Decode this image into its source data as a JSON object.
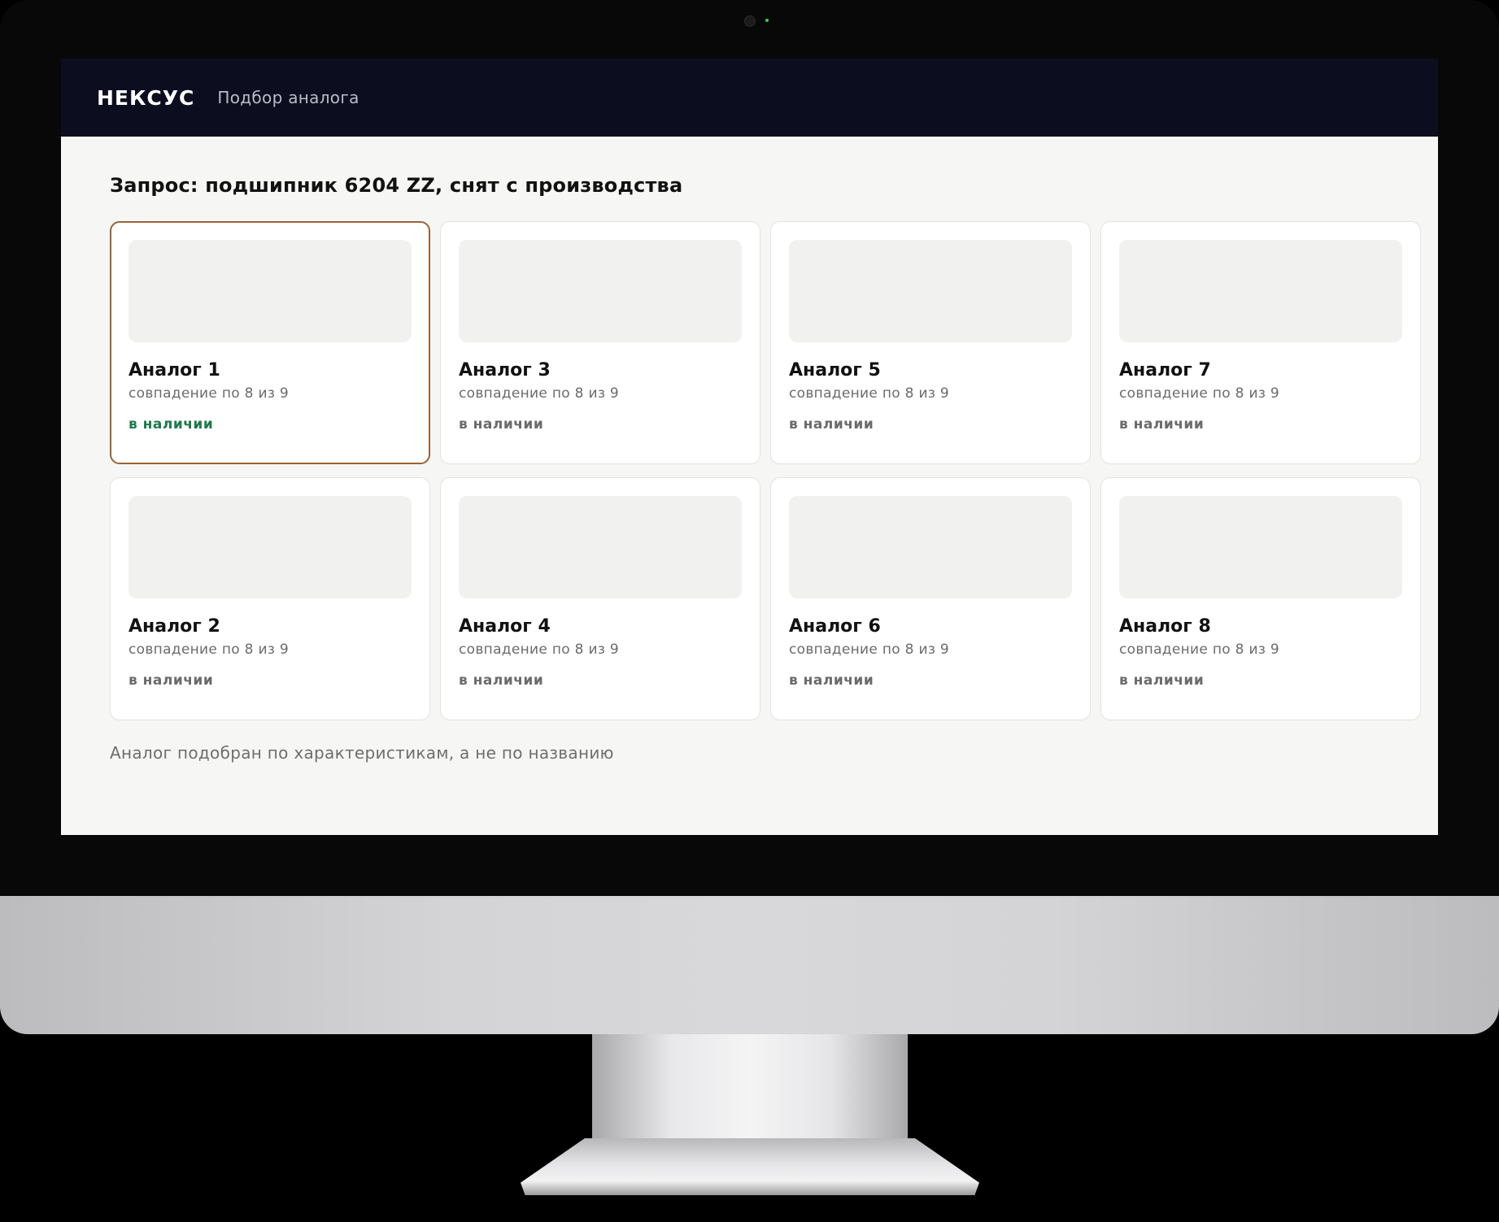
{
  "app": {
    "brand": "НЕКСУС",
    "subtitle": "Подбор аналога"
  },
  "query": {
    "text": "Запрос: подшипник 6204 ZZ, снят с производства"
  },
  "cards": [
    {
      "title": "Аналог 1",
      "match": "совпадение по 8 из 9",
      "stock": "в наличии",
      "selected": true
    },
    {
      "title": "Аналог 2",
      "match": "совпадение по 8 из 9",
      "stock": "в наличии",
      "selected": false
    },
    {
      "title": "Аналог 3",
      "match": "совпадение по 8 из 9",
      "stock": "в наличии",
      "selected": false
    },
    {
      "title": "Аналог 4",
      "match": "совпадение по 8 из 9",
      "stock": "в наличии",
      "selected": false
    },
    {
      "title": "Аналог 5",
      "match": "совпадение по 8 из 9",
      "stock": "в наличии",
      "selected": false
    },
    {
      "title": "Аналог 6",
      "match": "совпадение по 8 из 9",
      "stock": "в наличии",
      "selected": false
    },
    {
      "title": "Аналог 7",
      "match": "совпадение по 8 из 9",
      "stock": "в наличии",
      "selected": false
    },
    {
      "title": "Аналог 8",
      "match": "совпадение по 8 из 9",
      "stock": "в наличии",
      "selected": false
    }
  ],
  "footnote": "Аналог подобран по характеристикам, а не по названию",
  "colors": {
    "topbar": "#0c0e20",
    "selected_border": "#9a6236",
    "in_stock_selected": "#1e7a4c",
    "in_stock": "#6b6b6b"
  }
}
